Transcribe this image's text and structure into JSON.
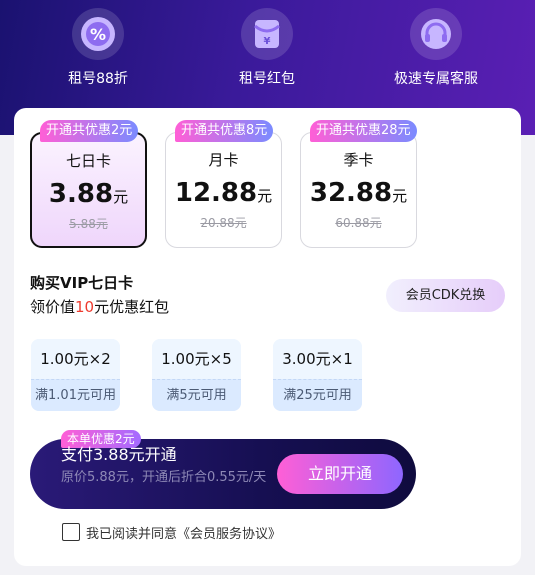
{
  "perks": [
    {
      "label": "租号88折",
      "icon": "percent-badge-icon"
    },
    {
      "label": "租号红包",
      "icon": "red-packet-icon"
    },
    {
      "label": "极速专属客服",
      "icon": "headset-icon"
    }
  ],
  "plans": [
    {
      "tag": "开通共优惠2元",
      "name": "七日卡",
      "price": "3.88",
      "unit": "元",
      "original": "5.88元",
      "selected": true
    },
    {
      "tag": "开通共优惠8元",
      "name": "月卡",
      "price": "12.88",
      "unit": "元",
      "original": "20.88元",
      "selected": false
    },
    {
      "tag": "开通共优惠28元",
      "name": "季卡",
      "price": "32.88",
      "unit": "元",
      "original": "60.88元",
      "selected": false
    }
  ],
  "purchase": {
    "title": "购买VIP七日卡",
    "coupon_prefix": "领价值",
    "coupon_amount": "10",
    "coupon_suffix": "元优惠红包",
    "cdk_label": "会员CDK兑换"
  },
  "coupons": [
    {
      "amount": "1.00元×2",
      "condition": "满1.01元可用"
    },
    {
      "amount": "1.00元×5",
      "condition": "满5元可用"
    },
    {
      "amount": "3.00元×1",
      "condition": "满25元可用"
    }
  ],
  "payment": {
    "tag": "本单优惠2元",
    "main": "支付3.88元开通",
    "sub": "原价5.88元，开通后折合0.55元/天",
    "button": "立即开通"
  },
  "agreement": {
    "text": "我已阅读并同意《会员服务协议》",
    "checked": false
  },
  "colors": {
    "hero_start": "#1a1270",
    "hero_end": "#5a1fb4",
    "accent_pink": "#ff5fd6",
    "accent_blue": "#7b8bff",
    "highlight_red": "#ee3a2e"
  }
}
